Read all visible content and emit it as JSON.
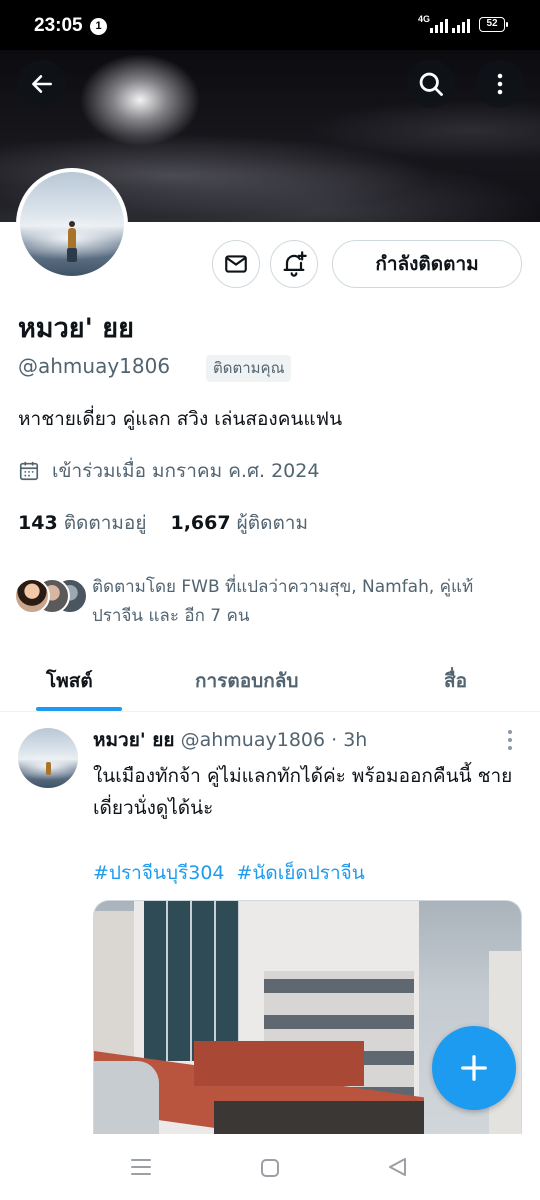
{
  "status_bar": {
    "time": "23:05",
    "notification_count": "1",
    "network": "4G",
    "battery": "52"
  },
  "profile": {
    "name": "หมวย' ยย",
    "handle": "@ahmuay1806",
    "follows_you_badge": "ติดตามคุณ",
    "bio": "หาชายเดี่ยว คู่แลก สวิง เล่นสองคนแฟน",
    "joined": "เข้าร่วมเมื่อ มกราคม ค.ศ. 2024",
    "following_count": "143",
    "following_label": "ติดตามอยู่",
    "followers_count": "1,667",
    "followers_label": "ผู้ติดตาม",
    "followed_by": "ติดตามโดย FWB ที่แปลว่าความสุข, Namfah, คู่แท้ ปราจีน และ อีก 7 คน"
  },
  "actions": {
    "following_button": "กำลังติดตาม"
  },
  "tabs": [
    {
      "label": "โพสต์",
      "active": true
    },
    {
      "label": "การตอบกลับ",
      "active": false
    },
    {
      "label": "สื่อ",
      "active": false
    }
  ],
  "post": {
    "name": "หมวย' ยย",
    "meta": "@ahmuay1806 · 3h",
    "text": "ในเมืองทักจ้า คู่ไม่แลกทักได้ค่ะ พร้อมออกคืนนี้ ชายเดี่ยวนั่งดูได้น่ะ",
    "hashtags": [
      "#ปราจีนบุรี304",
      "#นัดเย็ดปราจีน"
    ]
  },
  "colors": {
    "accent": "#1d9bf0",
    "text": "#0f1419",
    "secondary": "#536471"
  }
}
